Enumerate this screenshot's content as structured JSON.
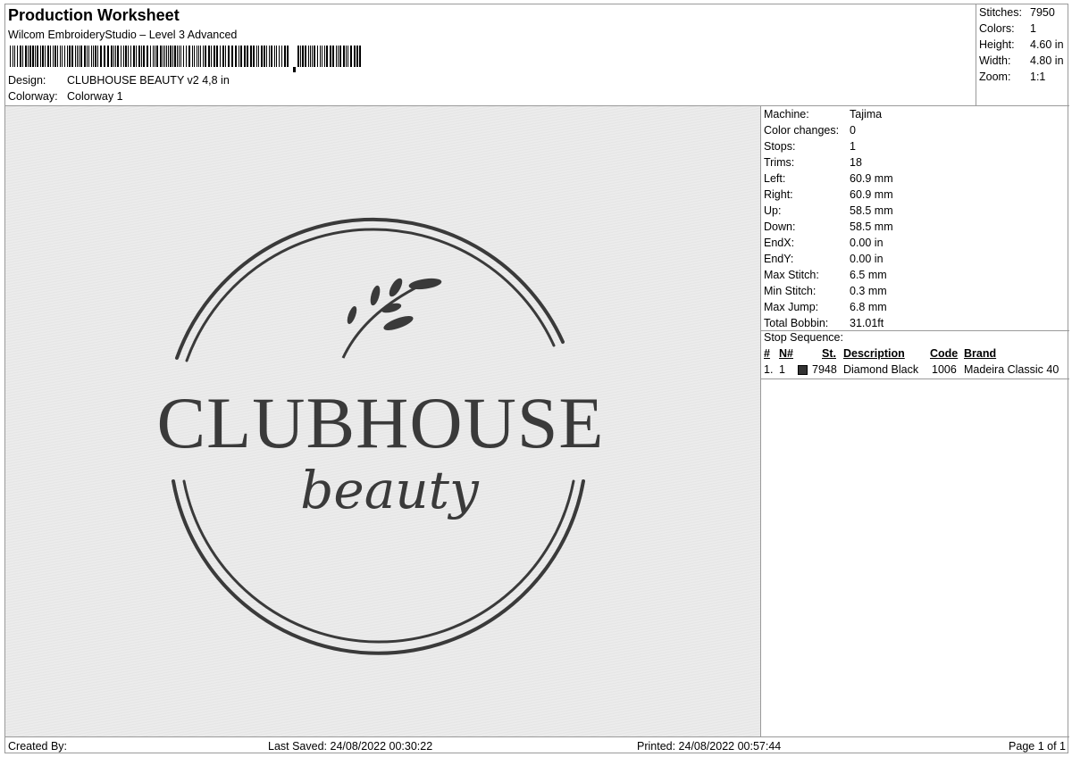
{
  "header": {
    "title": "Production Worksheet",
    "subtitle": "Wilcom EmbroideryStudio – Level 3 Advanced",
    "design_label": "Design:",
    "design_value": "CLUBHOUSE BEAUTY v2 4,8 in",
    "colorway_label": "Colorway:",
    "colorway_value": "Colorway 1"
  },
  "stats": [
    {
      "label": "Stitches:",
      "value": "7950"
    },
    {
      "label": "Colors:",
      "value": "1"
    },
    {
      "label": "Height:",
      "value": "4.60 in"
    },
    {
      "label": "Width:",
      "value": "4.80 in"
    },
    {
      "label": "Zoom:",
      "value": "1:1"
    }
  ],
  "machine_info": [
    {
      "label": "Machine:",
      "value": "Tajima"
    },
    {
      "label": "Color changes:",
      "value": "0"
    },
    {
      "label": "Stops:",
      "value": "1"
    },
    {
      "label": "Trims:",
      "value": "18"
    },
    {
      "label": "Left:",
      "value": "60.9 mm"
    },
    {
      "label": "Right:",
      "value": "60.9 mm"
    },
    {
      "label": "Up:",
      "value": "58.5 mm"
    },
    {
      "label": "Down:",
      "value": "58.5 mm"
    },
    {
      "label": "EndX:",
      "value": "0.00 in"
    },
    {
      "label": "EndY:",
      "value": "0.00 in"
    },
    {
      "label": "Max Stitch:",
      "value": "6.5 mm"
    },
    {
      "label": "Min Stitch:",
      "value": "0.3 mm"
    },
    {
      "label": "Max Jump:",
      "value": "6.8 mm"
    },
    {
      "label": "Total Bobbin:",
      "value": "31.01ft"
    }
  ],
  "stop_sequence": {
    "title": "Stop Sequence:",
    "columns": {
      "idx": "#",
      "num": "N#",
      "st": "St.",
      "description": "Description",
      "code": "Code",
      "brand": "Brand"
    },
    "rows": [
      {
        "idx": "1.",
        "num": "1",
        "color": "#333333",
        "st": "7948",
        "description": "Diamond Black",
        "code": "1006",
        "brand": "Madeira Classic 40"
      }
    ]
  },
  "design_preview": {
    "main_text": "CLUBHOUSE",
    "script_text": "beauty",
    "thread_color": "#3a3a3a"
  },
  "footer": {
    "created_by": "Created By:",
    "last_saved": "Last Saved: 24/08/2022 00:30:22",
    "printed": "Printed: 24/08/2022 00:57:44",
    "page": "Page 1 of 1"
  }
}
